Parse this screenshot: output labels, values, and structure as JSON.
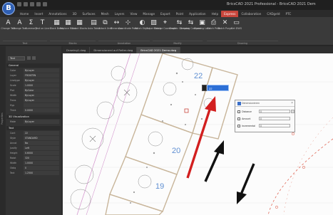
{
  "window": {
    "title": "BricsCAD 2021 Professional - BricsCAD 2021 Dem",
    "logo": "B"
  },
  "ribbon": {
    "tabs": [
      "Home",
      "Insert",
      "Annotations",
      "3D",
      "Surfaces",
      "Mesh",
      "Layers",
      "View",
      "Manage",
      "Export",
      "Point",
      "Application",
      "Help",
      "Express",
      "Collaboration",
      "CADgeld",
      "PTC"
    ],
    "active_tab": "Express",
    "tools": [
      {
        "label": "Change Text",
        "icon": "text-change-icon"
      },
      {
        "label": "Change Text",
        "icon": "text-change-icon"
      },
      {
        "label": "Summary",
        "icon": "sigma-icon"
      },
      {
        "label": "Text on Line",
        "icon": "text-on-line-icon"
      },
      {
        "label": "Block Break",
        "icon": "block-icon"
      },
      {
        "label": "Replace Block",
        "icon": "block-icon"
      },
      {
        "label": "Count Blocks",
        "icon": "block-icon"
      },
      {
        "label": "Auto Table",
        "icon": "table-icon"
      },
      {
        "label": "Attach Xref",
        "icon": "xref-icon"
      },
      {
        "label": "Dimension",
        "icon": "dimension-icon"
      },
      {
        "label": "Coordinate Point",
        "icon": "point-icon"
      },
      {
        "label": "Match Object",
        "icon": "match-icon"
      },
      {
        "label": "Super Hatch",
        "icon": "hatch-icon"
      },
      {
        "label": "Change Coordinate",
        "icon": "coordinate-icon"
      },
      {
        "label": "Graphic Compare",
        "icon": "compare-icon"
      },
      {
        "label": "Drawing Compare",
        "icon": "compare-icon"
      },
      {
        "label": "Drawing Lock",
        "icon": "lock-icon"
      },
      {
        "label": "Batch Print",
        "icon": "print-icon"
      },
      {
        "label": "Batch Purge",
        "icon": "purge-icon"
      },
      {
        "label": "Get DWG",
        "icon": "dwg-icon"
      }
    ],
    "groups": [
      "Text",
      "Blocks",
      "Annotation",
      "Modify",
      "Drawing"
    ]
  },
  "document_tabs": [
    "Drawing1.dwg",
    "Dimensionerd auf Reiter.dwg",
    "BricsCAD 2021 Demo.dwg"
  ],
  "active_document": "BricsCAD 2021 Demo.dwg",
  "properties": {
    "side_label": "Properties",
    "selector": "Text",
    "sections": [
      {
        "title": "General",
        "rows": [
          {
            "k": "Color",
            "v": "ByLayer"
          },
          {
            "k": "Layer",
            "v": "FRONTEN"
          },
          {
            "k": "Linetype",
            "v": "ByLayer"
          },
          {
            "k": "Scale",
            "v": "1.0000"
          },
          {
            "k": "Plot",
            "v": "ByColor"
          },
          {
            "k": "Width",
            "v": "ByLayer"
          },
          {
            "k": "Trans",
            "v": "ByLayer"
          },
          {
            "k": "Hyp",
            "v": ""
          },
          {
            "k": "Thick",
            "v": "0.0000"
          }
        ]
      },
      {
        "title": "3D Visualization",
        "rows": [
          {
            "k": "Mate",
            "v": "ByLayer"
          }
        ]
      },
      {
        "title": "Text",
        "rows": [
          {
            "k": "Cont",
            "v": "22"
          },
          {
            "k": "Style",
            "v": "STANDARD"
          },
          {
            "k": "Annot",
            "v": "No"
          },
          {
            "k": "Justify",
            "v": "Left"
          },
          {
            "k": "Height",
            "v": "0.6000"
          },
          {
            "k": "Rotat",
            "v": "320"
          },
          {
            "k": "Width",
            "v": "1.0000"
          },
          {
            "k": "Obliq",
            "v": "0"
          },
          {
            "k": "Text",
            "v": "1.2500"
          }
        ]
      }
    ]
  },
  "canvas": {
    "plot_numbers": [
      "22",
      "20",
      "19"
    ],
    "edit_value": "22",
    "colors": {
      "annotation_arrow": "#d21f1f",
      "hint_arrow": "#111111",
      "boundary": "#e06a5a",
      "plot_outline": "#c8b59a"
    }
  },
  "dialog": {
    "title": "Dimensionieren",
    "rows": [
      {
        "label": "Distance",
        "value": "0"
      },
      {
        "label": "Amount",
        "value": "0"
      },
      {
        "label": "Incremental",
        "value": "0"
      }
    ]
  }
}
